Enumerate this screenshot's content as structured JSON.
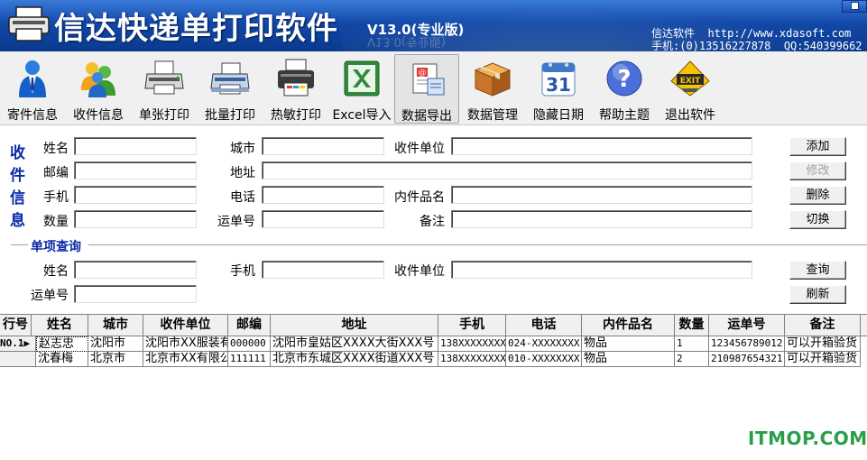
{
  "window": {
    "title": "信达快递单打印软件",
    "version": "V13.0(专业版)",
    "company_line": "信达软件  http://www.xdasoft.com",
    "phone_line": "手机:(0)13516227878  QQ:540399662"
  },
  "toolbar": {
    "items": [
      {
        "label": "寄件信息",
        "icon": "sender-person-icon"
      },
      {
        "label": "收件信息",
        "icon": "recipients-users-icon"
      },
      {
        "label": "单张打印",
        "icon": "printer-icon"
      },
      {
        "label": "批量打印",
        "icon": "batch-printer-icon"
      },
      {
        "label": "热敏打印",
        "icon": "thermal-printer-icon"
      },
      {
        "label": "Excel导入",
        "icon": "excel-icon"
      },
      {
        "label": "数据导出",
        "icon": "export-icon"
      },
      {
        "label": "数据管理",
        "icon": "box-icon"
      },
      {
        "label": "隐藏日期",
        "icon": "calendar-icon"
      },
      {
        "label": "帮助主题",
        "icon": "help-icon"
      },
      {
        "label": "退出软件",
        "icon": "exit-sign-icon"
      }
    ],
    "calendar_day": "31",
    "exit_sign_text": "EXIT"
  },
  "recipient_form": {
    "side_label": [
      "收",
      "件",
      "信",
      "息"
    ],
    "name_label": "姓名",
    "name_value": "",
    "city_label": "城市",
    "city_value": "",
    "unit_label": "收件单位",
    "unit_value": "",
    "zip_label": "邮编",
    "zip_value": "",
    "address_label": "地址",
    "address_value": "",
    "mobile_label": "手机",
    "mobile_value": "",
    "phone_label": "电话",
    "phone_value": "",
    "item_label": "内件品名",
    "item_value": "",
    "qty_label": "数量",
    "qty_value": "",
    "waybill_label": "运单号",
    "waybill_value": "",
    "note_label": "备注",
    "note_value": "",
    "buttons": {
      "add": "添加",
      "modify": "修改",
      "delete": "删除",
      "switch": "切换"
    }
  },
  "query": {
    "title": "单项查询",
    "name_label": "姓名",
    "name_value": "",
    "mobile_label": "手机",
    "mobile_value": "",
    "unit_label": "收件单位",
    "unit_value": "",
    "waybill_label": "运单号",
    "waybill_value": "",
    "buttons": {
      "query": "查询",
      "refresh": "刷新"
    }
  },
  "grid": {
    "columns": [
      "行号",
      "姓名",
      "城市",
      "收件单位",
      "邮编",
      "地址",
      "手机",
      "电话",
      "内件品名",
      "数量",
      "运单号",
      "备注"
    ],
    "rows": [
      {
        "row_no": "NO.1",
        "current": true,
        "cells": [
          "赵志忠",
          "沈阳市",
          "沈阳市XX服装有",
          "000000",
          "沈阳市皇姑区XXXX大街XXX号",
          "138XXXXXXXX",
          "024-XXXXXXXX",
          "物品",
          "1",
          "123456789012",
          "可以开箱验货"
        ]
      },
      {
        "row_no": "",
        "current": false,
        "cells": [
          "沈春梅",
          "北京市",
          "北京市XX有限公",
          "111111",
          "北京市东城区XXXX街道XXX号",
          "138XXXXXXXX",
          "010-XXXXXXXX",
          "物品",
          "2",
          "210987654321",
          "可以开箱验货"
        ]
      }
    ]
  },
  "watermark": "ITMOP.COM"
}
